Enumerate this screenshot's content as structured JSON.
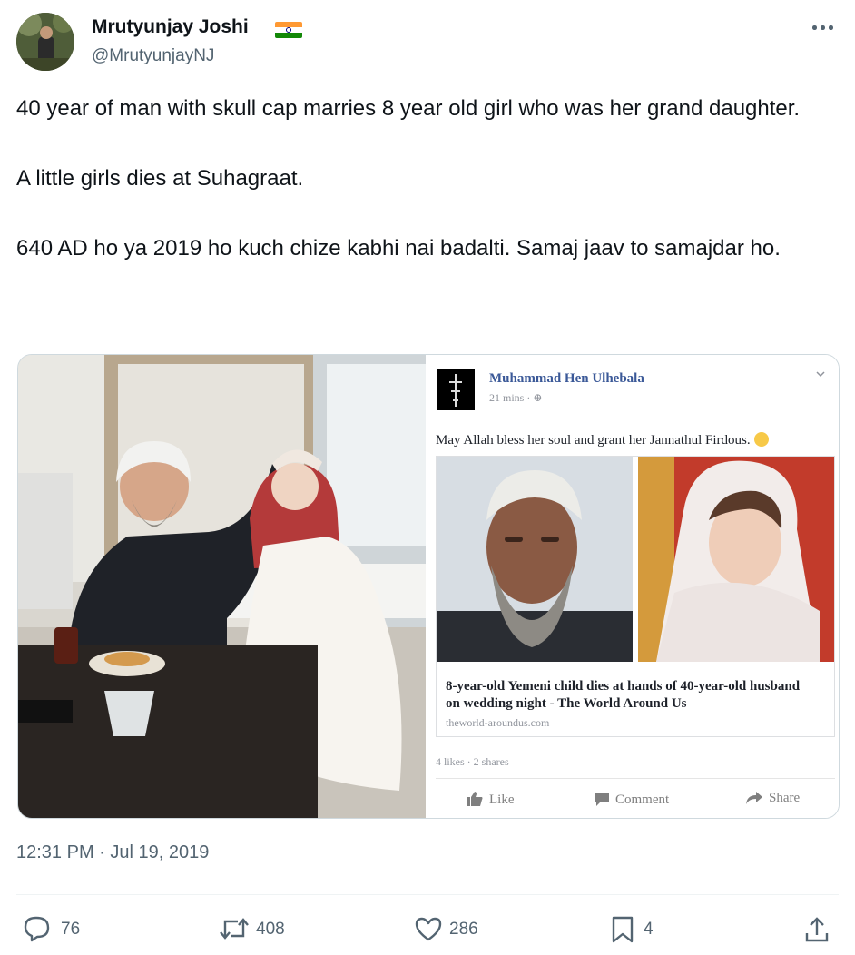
{
  "author": {
    "display_name": "Mrutyunjay Joshi",
    "handle": "@MrutyunjayNJ",
    "flag_icon": "india-flag-emoji"
  },
  "tweet": {
    "text": "40 year of man with skull cap marries 8 year old girl who was her grand daughter.\n\nA little girls dies at Suhagraat.\n\n640 AD ho ya 2019 ho kuch chize kabhi nai badalti. Samaj jaav to samajdar ho.",
    "timestamp": "12:31 PM · Jul 19, 2019"
  },
  "facebook_post": {
    "author": "Muhammad Hen Ulhebala",
    "time": "21 mins",
    "text": "May Allah bless her soul and grant her Jannathul Firdous.",
    "link_title": "8-year-old Yemeni child dies at hands of 40-year-old husband on wedding night - The World Around Us",
    "link_domain": "theworld-aroundus.com",
    "counts": "4 likes · 2 shares",
    "actions": {
      "like": "Like",
      "comment": "Comment",
      "share": "Share"
    }
  },
  "stats": {
    "replies": "76",
    "reposts": "408",
    "likes": "286",
    "bookmarks": "4"
  },
  "colors": {
    "text": "#0f1419",
    "secondary": "#536471",
    "border": "#cfd9de",
    "facebook_blue": "#3b5998"
  }
}
